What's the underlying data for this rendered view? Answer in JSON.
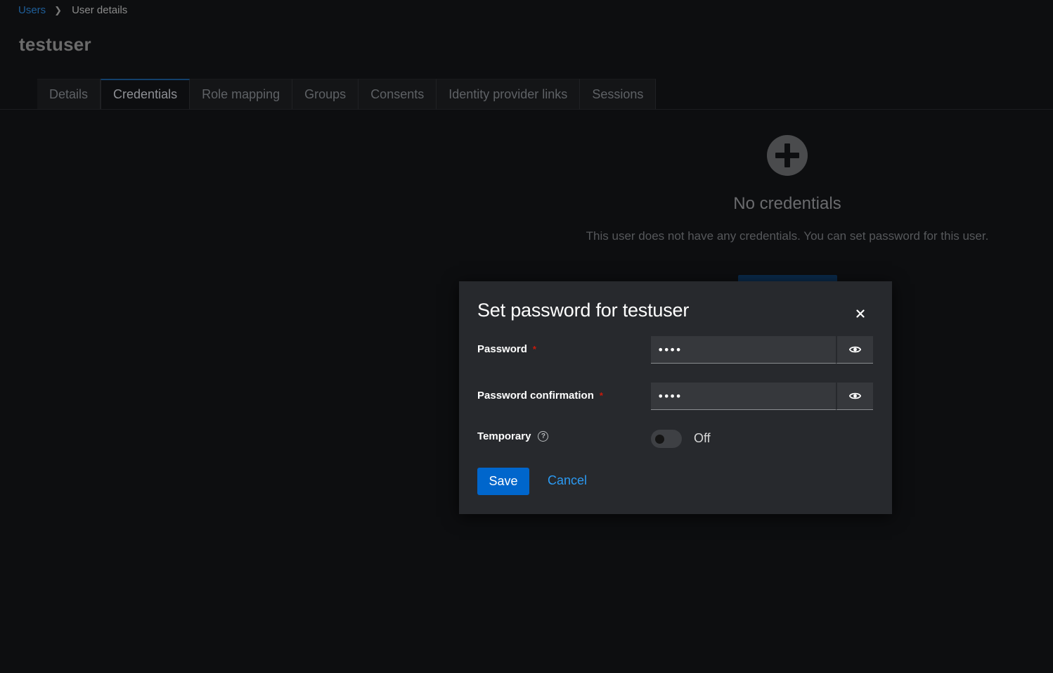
{
  "breadcrumb": {
    "parent": "Users",
    "current": "User details"
  },
  "page": {
    "title": "testuser"
  },
  "tabs": [
    {
      "label": "Details"
    },
    {
      "label": "Credentials"
    },
    {
      "label": "Role mapping"
    },
    {
      "label": "Groups"
    },
    {
      "label": "Consents"
    },
    {
      "label": "Identity provider links"
    },
    {
      "label": "Sessions"
    }
  ],
  "active_tab": "Credentials",
  "empty_state": {
    "icon": "plus-circle-icon",
    "title": "No credentials",
    "body": "This user does not have any credentials. You can set password for this user."
  },
  "modal": {
    "title": "Set password for testuser",
    "close_icon": "close-icon",
    "password": {
      "label": "Password",
      "required_mark": "*",
      "value": "••••",
      "toggle_icon": "eye-icon"
    },
    "password_confirmation": {
      "label": "Password confirmation",
      "required_mark": "*",
      "value": "••••",
      "toggle_icon": "eye-icon"
    },
    "temporary": {
      "label": "Temporary",
      "help_icon": "help-icon",
      "state_label": "Off",
      "on": false
    },
    "save_label": "Save",
    "cancel_label": "Cancel"
  },
  "colors": {
    "primary": "#0066cc",
    "link": "#2b9af3",
    "required": "#c9190b",
    "modal_bg": "#27292d",
    "page_bg": "#0d0e10"
  }
}
